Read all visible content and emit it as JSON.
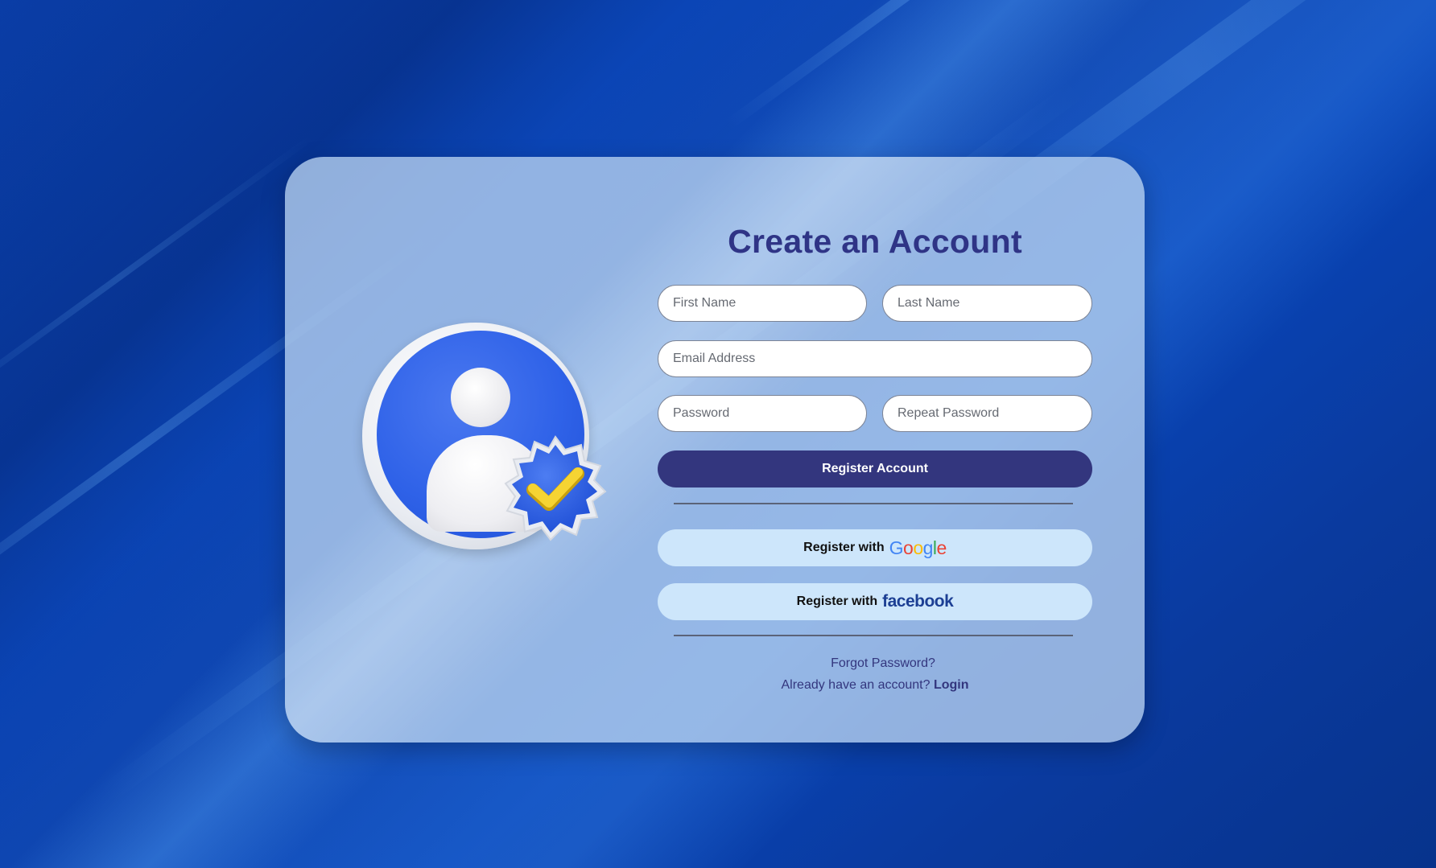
{
  "title": "Create an Account",
  "fields": {
    "first_name": {
      "placeholder": "First Name",
      "value": ""
    },
    "last_name": {
      "placeholder": "Last Name",
      "value": ""
    },
    "email": {
      "placeholder": "Email Address",
      "value": ""
    },
    "password": {
      "placeholder": "Password",
      "value": ""
    },
    "repeat_password": {
      "placeholder": "Repeat Password",
      "value": ""
    }
  },
  "buttons": {
    "register": "Register Account",
    "google_prefix": "Register with",
    "google_brand": "Google",
    "facebook_prefix": "Register with",
    "facebook_brand": "facebook"
  },
  "links": {
    "forgot_password": "Forgot Password?",
    "have_account": "Already have an account?",
    "login": "Login"
  },
  "icons": {
    "illustration": "verified-user-icon",
    "badge": "checkmark-badge-icon"
  },
  "colors": {
    "primary": "#33367e",
    "title": "#2f3486",
    "social_button_bg": "#cde6fb",
    "card_bg": "#b9d2f0",
    "background": "#0a3fa8",
    "badge_check": "#f2c91e"
  }
}
